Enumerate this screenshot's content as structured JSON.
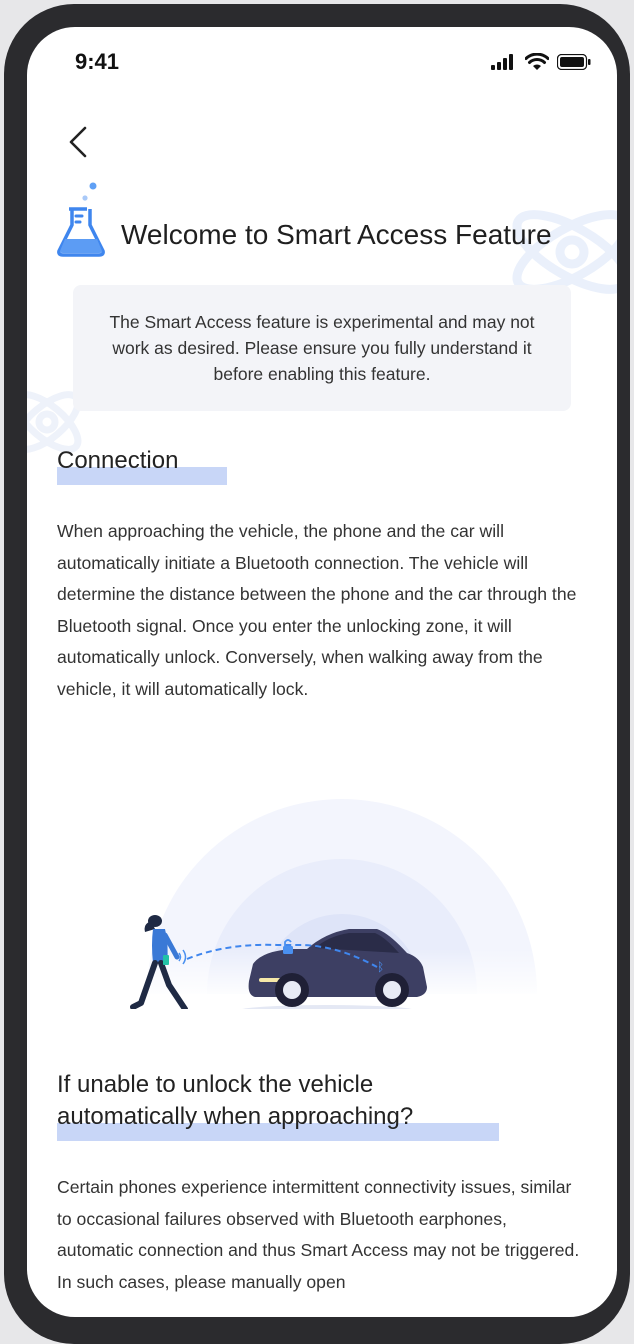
{
  "status_bar": {
    "time": "9:41"
  },
  "header": {
    "title": "Welcome to Smart Access Feature"
  },
  "notice": {
    "text": "The Smart Access feature is experimental and may not work as desired. Please ensure you fully understand it before enabling this feature."
  },
  "sections": [
    {
      "heading": "Connection",
      "body": "When approaching the vehicle, the phone and the car will automatically initiate a Bluetooth connection. The vehicle will determine the distance between the phone and the car through the Bluetooth signal. Once you enter the unlocking zone, it will automatically unlock. Conversely, when walking away from the vehicle, it will automatically lock."
    },
    {
      "heading": "If unable to unlock the vehicle automatically when approaching?",
      "body": "Certain phones experience intermittent connectivity issues, similar to occasional failures observed with Bluetooth earphones, automatic connection and thus Smart Access may not be triggered. In such cases, please manually open"
    }
  ],
  "icons": {
    "back": "chevron-left-icon",
    "flask": "flask-icon",
    "signal": "signal-icon",
    "wifi": "wifi-icon",
    "battery": "battery-icon"
  },
  "colors": {
    "accent": "#4a90f0",
    "highlight": "#c8d6f7",
    "notice_bg": "#f3f4f8",
    "car": "#3d3f63"
  }
}
